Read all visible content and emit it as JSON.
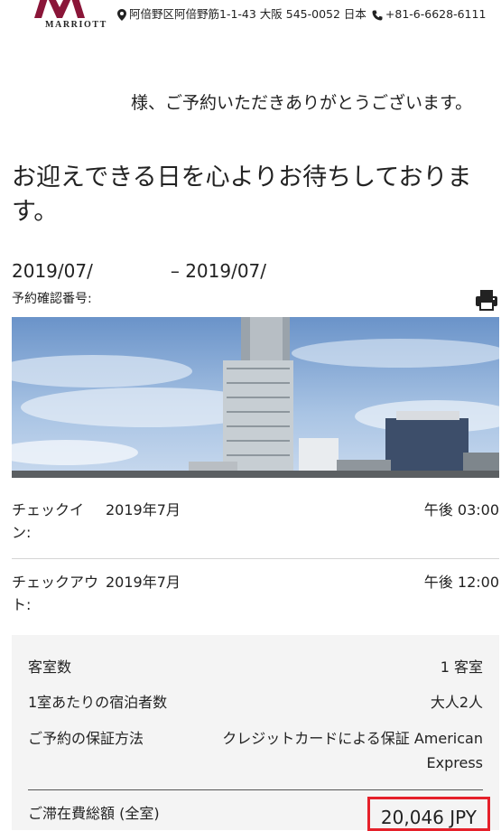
{
  "header": {
    "brand": "MARRIOTT",
    "address": "阿倍野区阿倍野筋1-1-43 大阪 545-0052 日本",
    "phone": "+81-6-6628-6111"
  },
  "greeting": "様、ご予約いただきありがとうございます。",
  "headline": "お迎えできる日を心よりお待ちしております。",
  "stay": {
    "date_from": "2019/07/",
    "date_sep": "–",
    "date_to": "2019/07/",
    "confirmation_label": "予約確認番号:"
  },
  "checkin": {
    "label": "チェックイン:",
    "date": "2019年7月",
    "time": "午後 03:00"
  },
  "checkout": {
    "label": "チェックアウト:",
    "date": "2019年7月",
    "time": "午後 12:00"
  },
  "summary": {
    "rooms_label": "客室数",
    "rooms_value": "1 客室",
    "guests_label": "1室あたりの宿泊者数",
    "guests_value": "大人2人",
    "guarantee_label": "ご予約の保証方法",
    "guarantee_value": "クレジットカードによる保証 American Express",
    "total_label": "ご滞在費総額 (全室)",
    "total_value": "20,046 JPY"
  },
  "colors": {
    "highlight_border": "#e5202a",
    "brand": "#8a1538",
    "panel_bg": "#f4f4f4"
  },
  "icons": [
    "map-pin-icon",
    "phone-icon",
    "print-icon"
  ]
}
